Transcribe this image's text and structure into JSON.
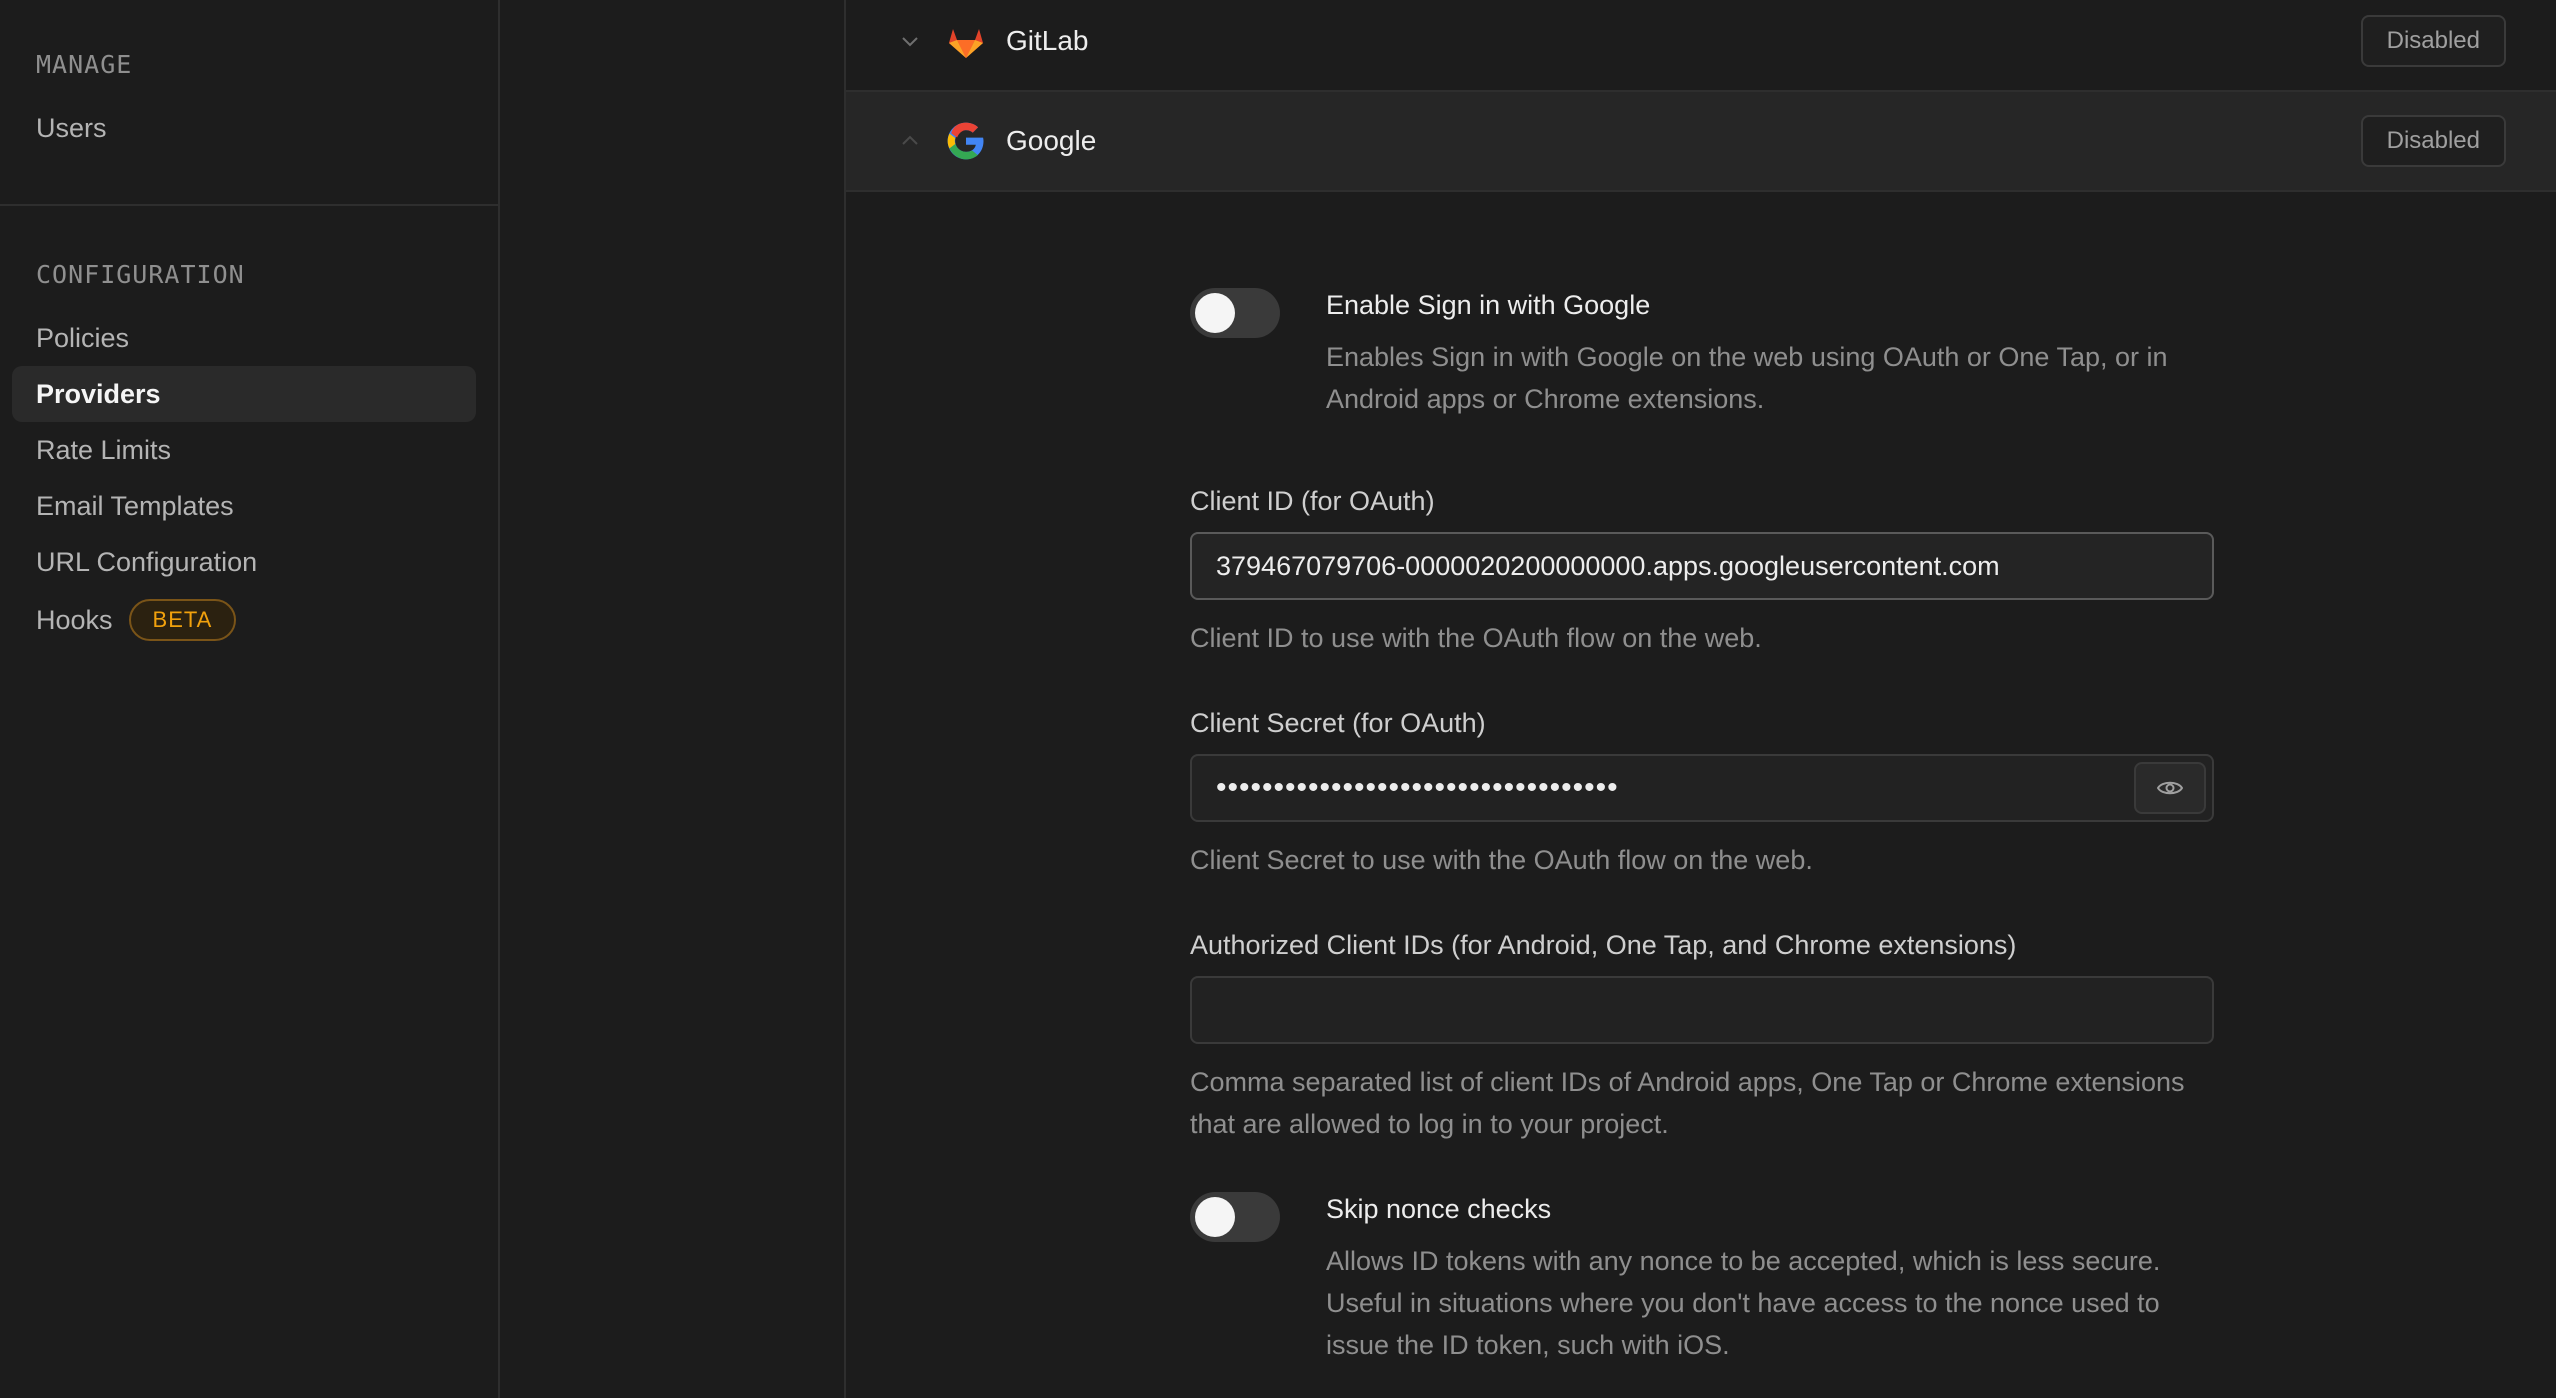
{
  "sidebar": {
    "manage_title": "MANAGE",
    "manage_items": [
      {
        "label": "Users"
      }
    ],
    "config_title": "CONFIGURATION",
    "config_items": [
      {
        "label": "Policies"
      },
      {
        "label": "Providers",
        "active": true
      },
      {
        "label": "Rate Limits"
      },
      {
        "label": "Email Templates"
      },
      {
        "label": "URL Configuration"
      },
      {
        "label": "Hooks",
        "badge": "BETA"
      }
    ]
  },
  "providers": [
    {
      "name": "GitLab",
      "status": "Disabled",
      "expanded": false,
      "icon": "gitlab-icon"
    },
    {
      "name": "Google",
      "status": "Disabled",
      "expanded": true,
      "icon": "google-icon"
    }
  ],
  "google_form": {
    "enable": {
      "title": "Enable Sign in with Google",
      "description": "Enables Sign in with Google on the web using OAuth or One Tap, or in Android apps or Chrome extensions.",
      "enabled": false
    },
    "client_id": {
      "label": "Client ID (for OAuth)",
      "value": "379467079706-0000020200000000.apps.googleusercontent.com",
      "help": "Client ID to use with the OAuth flow on the web."
    },
    "client_secret": {
      "label": "Client Secret (for OAuth)",
      "value": "•••••••••••••••••••••••••••••••••••",
      "help": "Client Secret to use with the OAuth flow on the web.",
      "reveal_icon": "eye-icon"
    },
    "authorized_ids": {
      "label": "Authorized Client IDs (for Android, One Tap, and Chrome extensions)",
      "value": "",
      "help": "Comma separated list of client IDs of Android apps, One Tap or Chrome extensions that are allowed to log in to your project."
    },
    "skip_nonce": {
      "title": "Skip nonce checks",
      "description": "Allows ID tokens with any nonce to be accepted, which is less secure. Useful in situations where you don't have access to the nonce used to issue the ID token, such with iOS.",
      "enabled": false
    }
  },
  "colors": {
    "background": "#1c1c1c",
    "accent_badge": "#f1a10d",
    "border": "#2e2e2e"
  }
}
